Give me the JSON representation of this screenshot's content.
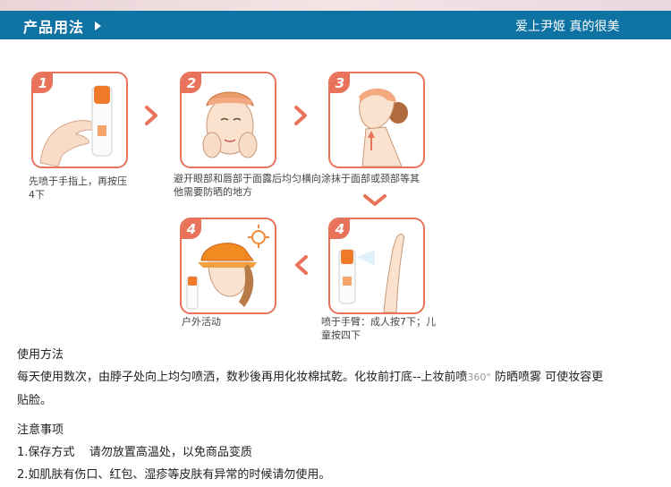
{
  "header": {
    "title": "产品用法",
    "slogan": "爱上尹姬 真的很美"
  },
  "steps": [
    {
      "badge": "1",
      "caption": "先喷于手指上，再按压4下"
    },
    {
      "badge": "2",
      "caption": "避开眼部和唇部于面露后均匀横向涂抹于面部或颈部等其他需要防晒的地方"
    },
    {
      "badge": "3",
      "caption": ""
    },
    {
      "badge": "4",
      "caption": "喷于手臂：成人按7下；儿童按四下"
    },
    {
      "badge": "4",
      "caption": "户外活动"
    }
  ],
  "usage": {
    "heading": "使用方法",
    "line1_a": "每天使用数次，由脖子处向上均匀喷洒，数秒後再用化妆棉拭乾。化妆前打底--上妆前喷",
    "line1_num": "360°",
    "line1_b": "防晒喷雾  可使妆容更",
    "line2": "贴脸。"
  },
  "notes": {
    "heading": "注意事项",
    "item1": "1.保存方式    请勿放置高温处，以免商品变质",
    "item2": "2.如肌肤有伤口、红包、湿疹等皮肤有异常的时候请勿使用。"
  },
  "colors": {
    "header_bg": "#0e73a3",
    "accent": "#e8735a"
  }
}
